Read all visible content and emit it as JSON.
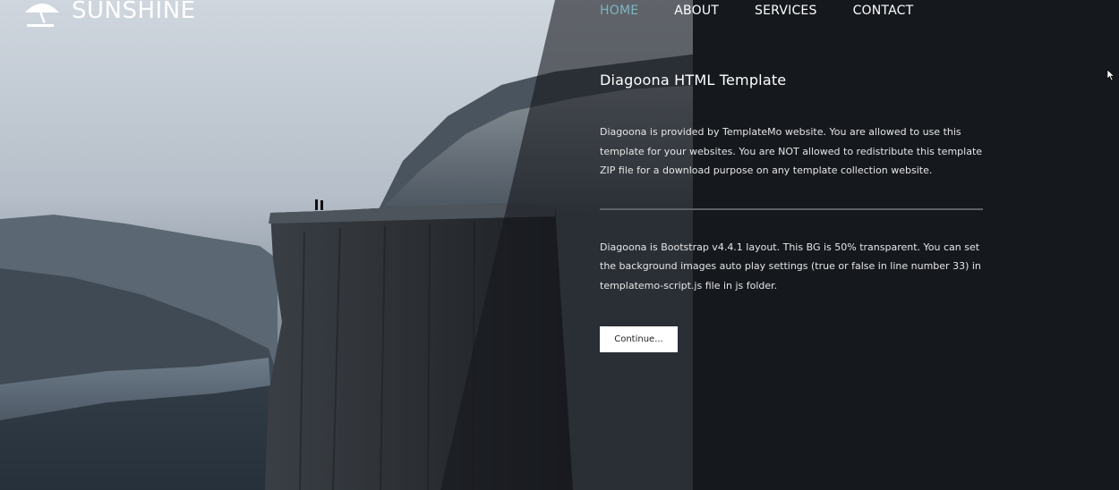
{
  "brand": {
    "name": "SUNSHINE",
    "icon": "umbrella-icon"
  },
  "nav": {
    "items": [
      {
        "label": "HOME",
        "active": true
      },
      {
        "label": "ABOUT",
        "active": false
      },
      {
        "label": "SERVICES",
        "active": false
      },
      {
        "label": "CONTACT",
        "active": false
      }
    ]
  },
  "content": {
    "title": "Diagoona HTML Template",
    "paragraph1": "Diagoona is provided by TemplateMo website. You are allowed to use this template for your websites. You are NOT allowed to redistribute this template ZIP file for a download purpose on any template collection website.",
    "paragraph2": "Diagoona is Bootstrap v4.4.1 layout. This BG is 50% transparent. You can set the background images auto play settings (true or false in line number 33) in templatemo-script.js file in js folder.",
    "button_label": "Continue..."
  },
  "colors": {
    "active_nav": "#7fb3c2",
    "panel": "#15181d",
    "button_bg": "#ffffff"
  }
}
